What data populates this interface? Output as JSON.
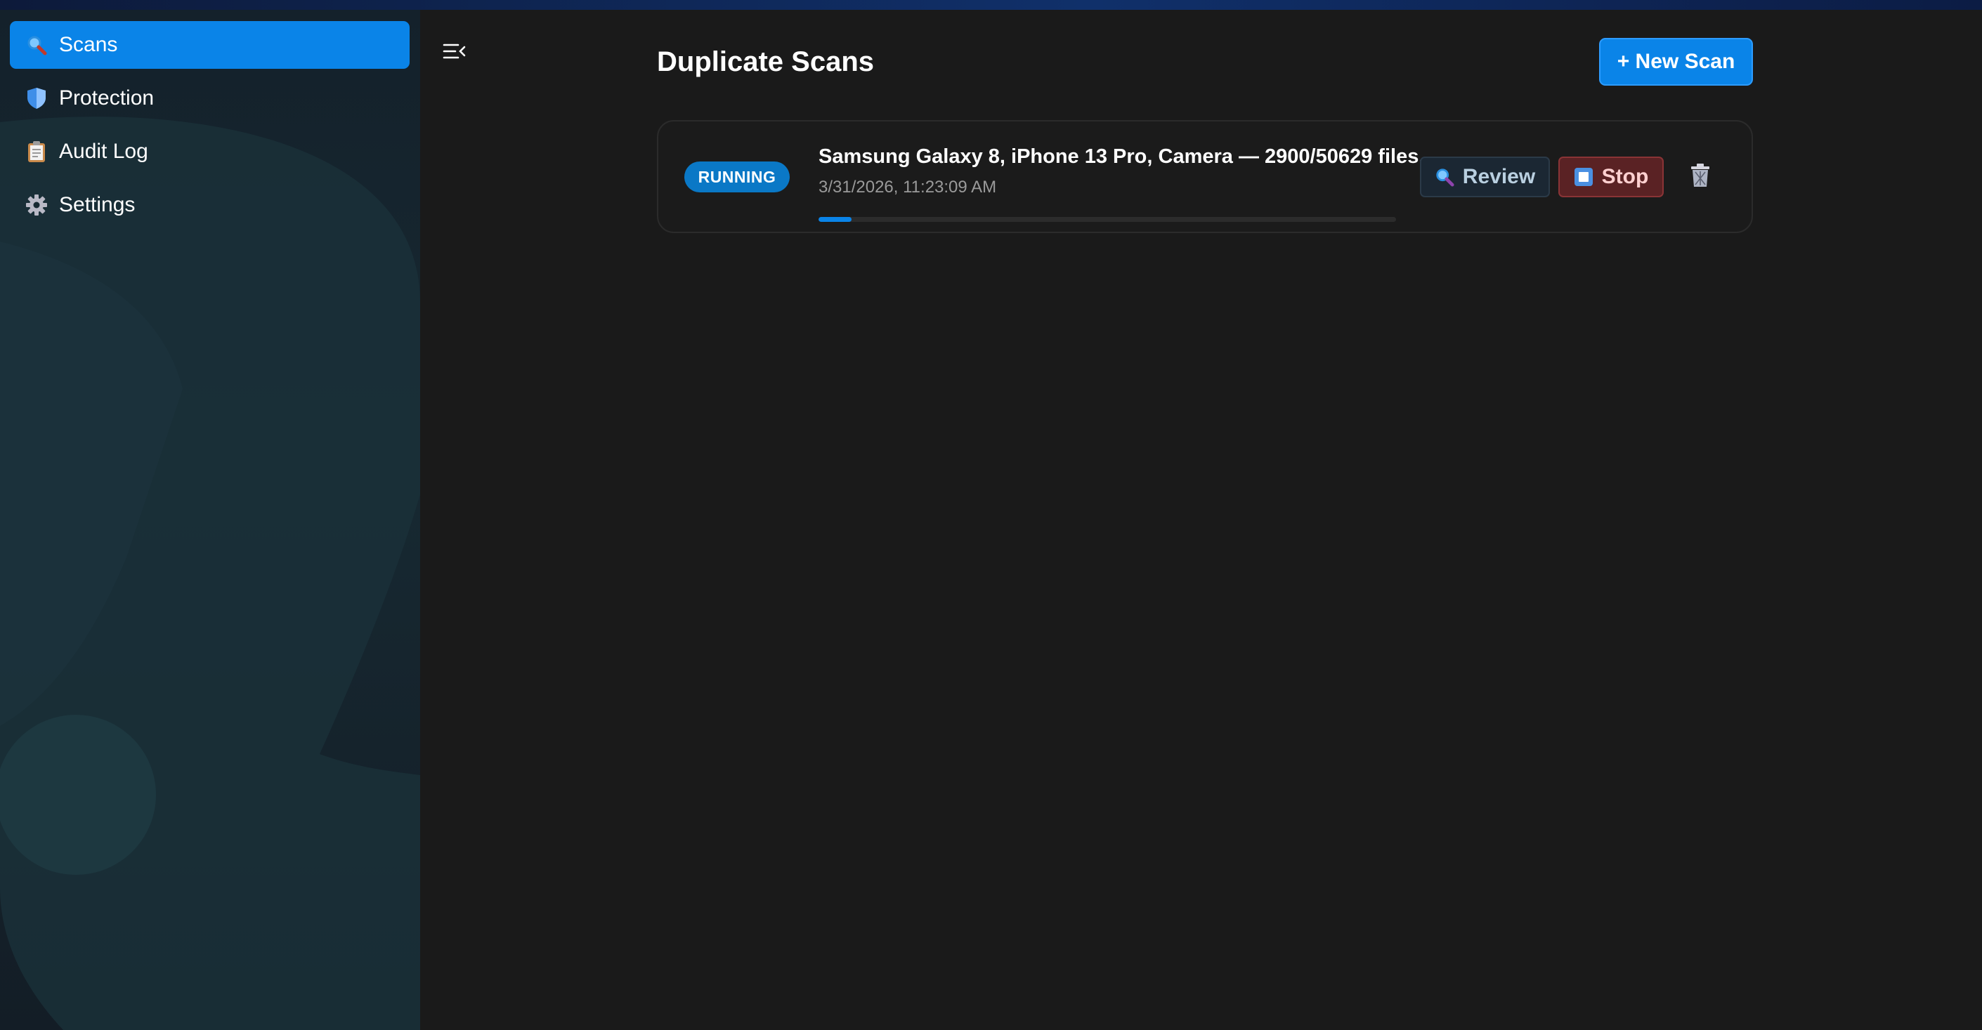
{
  "sidebar": {
    "items": [
      {
        "label": "Scans",
        "icon": "magnifier-icon",
        "active": true
      },
      {
        "label": "Protection",
        "icon": "shield-icon",
        "active": false
      },
      {
        "label": "Audit Log",
        "icon": "clipboard-icon",
        "active": false
      },
      {
        "label": "Settings",
        "icon": "gear-icon",
        "active": false
      }
    ]
  },
  "header": {
    "title": "Duplicate Scans",
    "new_scan_label": "+ New Scan",
    "collapse_icon": "collapse-sidebar-icon"
  },
  "scans": [
    {
      "status": "RUNNING",
      "name": "Samsung Galaxy 8, iPhone 13 Pro, Camera — 2900/50629 files...",
      "date": "3/31/2026, 11:23:09 AM",
      "progress_fraction": 0.057,
      "review_label": "Review",
      "stop_label": "Stop",
      "delete_icon": "trash-icon"
    }
  ],
  "colors": {
    "accent": "#0a84e8",
    "badge": "#0a78c6",
    "stop_bg": "#5a2224",
    "review_bg": "#1b2733",
    "background": "#1a1a1a"
  }
}
